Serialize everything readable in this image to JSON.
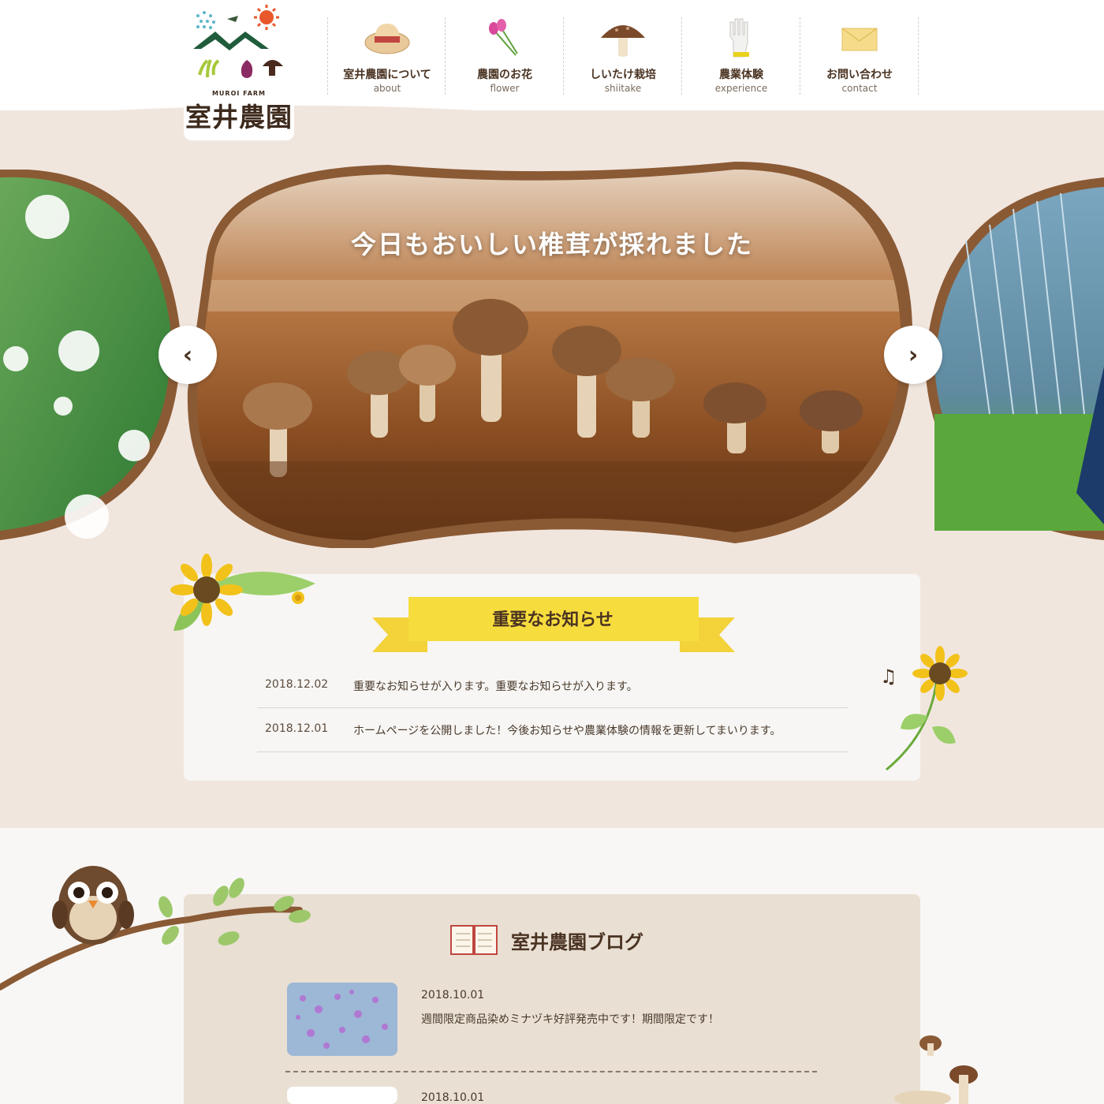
{
  "logo": {
    "en": "MUROI FARM",
    "jp": "室井農園"
  },
  "nav": [
    {
      "label": "室井農園について",
      "sub": "about",
      "icon": "straw-hat-icon"
    },
    {
      "label": "農園のお花",
      "sub": "flower",
      "icon": "flower-icon"
    },
    {
      "label": "しいたけ栽培",
      "sub": "shiitake",
      "icon": "mushroom-icon"
    },
    {
      "label": "農業体験",
      "sub": "experience",
      "icon": "glove-icon"
    },
    {
      "label": "お問い合わせ",
      "sub": "contact",
      "icon": "envelope-icon"
    }
  ],
  "slider": {
    "caption": "今日もおいしい椎茸が採れました",
    "prev_icon": "chevron-left-icon",
    "next_icon": "chevron-right-icon",
    "prev_glyph": "‹",
    "next_glyph": "›"
  },
  "notice": {
    "title": "重要なお知らせ",
    "items": [
      {
        "date": "2018.12.02",
        "text": "重要なお知らせが入ります。重要なお知らせが入ります。"
      },
      {
        "date": "2018.12.01",
        "text": "ホームページを公開しました！今後お知らせや農業体験の情報を更新してまいります。"
      }
    ]
  },
  "blog": {
    "title": "室井農園ブログ",
    "items": [
      {
        "date": "2018.10.01",
        "text": "週間限定商品染めミナヅキ好評発売中です！期間限定です！"
      },
      {
        "date": "2018.10.01",
        "text": ""
      }
    ]
  },
  "colors": {
    "beige": "#f1e6de",
    "wood": "#8a5a35",
    "brown_text": "#4a3322",
    "ribbon": "#f6d43a"
  }
}
